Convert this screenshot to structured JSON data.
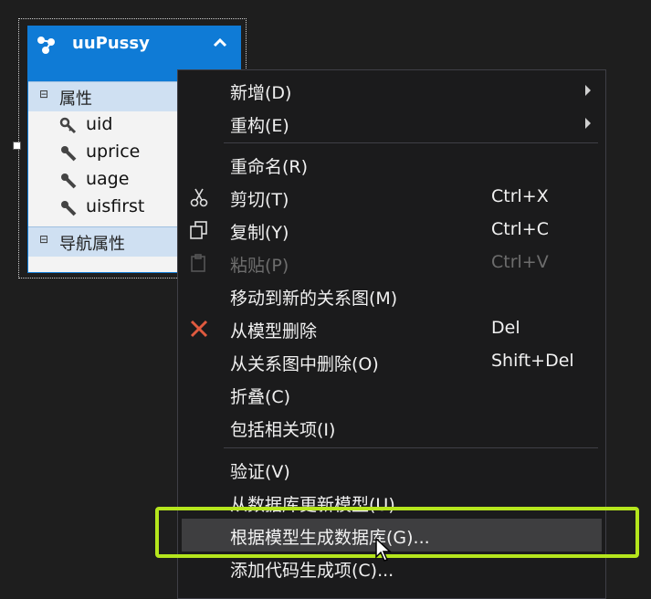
{
  "entity": {
    "title": "uuPussy",
    "properties_section": "属性",
    "properties": [
      {
        "name": "uid",
        "icon": "key-icon"
      },
      {
        "name": "uprice",
        "icon": "wrench-icon"
      },
      {
        "name": "uage",
        "icon": "wrench-icon"
      },
      {
        "name": "uisfirst",
        "icon": "wrench-icon"
      }
    ],
    "nav_section": "导航属性",
    "accent_color": "#0f7bd6"
  },
  "menu": {
    "items": [
      {
        "label": "新增(D)",
        "shortcut": "",
        "submenu": true
      },
      {
        "label": "重构(E)",
        "shortcut": "",
        "submenu": true
      },
      {
        "label": "重命名(R)",
        "shortcut": ""
      },
      {
        "label": "剪切(T)",
        "shortcut": "Ctrl+X",
        "icon": "scissors-icon"
      },
      {
        "label": "复制(Y)",
        "shortcut": "Ctrl+C",
        "icon": "copy-icon"
      },
      {
        "label": "粘贴(P)",
        "shortcut": "Ctrl+V",
        "icon": "paste-icon",
        "disabled": true
      },
      {
        "label": "移动到新的关系图(M)",
        "shortcut": ""
      },
      {
        "label": "从模型删除",
        "shortcut": "Del",
        "icon": "delete-icon"
      },
      {
        "label": "从关系图中删除(O)",
        "shortcut": "Shift+Del"
      },
      {
        "label": "折叠(C)",
        "shortcut": ""
      },
      {
        "label": "包括相关项(I)",
        "shortcut": ""
      },
      {
        "label": "验证(V)",
        "shortcut": ""
      },
      {
        "label": "从数据库更新模型(U)...",
        "shortcut": ""
      },
      {
        "label": "根据模型生成数据库(G)...",
        "shortcut": "",
        "hovered": true
      },
      {
        "label": "添加代码生成项(C)...",
        "shortcut": ""
      }
    ],
    "highlight_color": "#b5e61d",
    "delete_color": "#e05a3f"
  }
}
